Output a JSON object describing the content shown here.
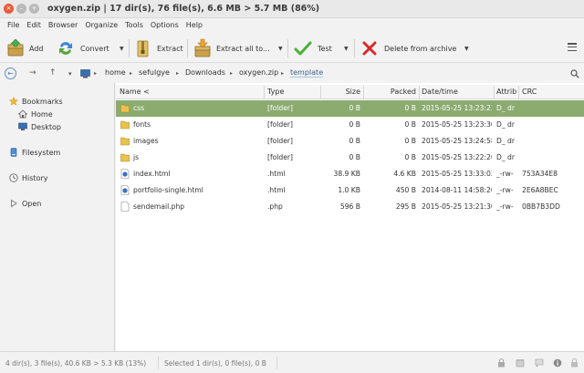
{
  "window": {
    "title": "oxygen.zip | 17 dir(s), 76 file(s), 6.6 MB > 5.7 MB (86%)",
    "close_glyph": "×",
    "min_glyph": "–",
    "max_glyph": "+"
  },
  "menu": [
    "File",
    "Edit",
    "Browser",
    "Organize",
    "Tools",
    "Options",
    "Help"
  ],
  "toolbar": {
    "add": "Add",
    "convert": "Convert",
    "extract": "Extract",
    "extract_all": "Extract all to...",
    "test": "Test",
    "delete": "Delete from archive",
    "dropdown_glyph": "▼"
  },
  "navbar": {
    "back_glyph": "←",
    "forward_glyph": "→",
    "up_glyph": "↑",
    "dropdown_glyph": "▾",
    "crumbs": [
      "home",
      "sefulgye",
      "Downloads",
      "oxygen.zip",
      "template"
    ],
    "separator_glyph": "▸"
  },
  "sidebar": {
    "bookmarks": "Bookmarks",
    "home": "Home",
    "desktop": "Desktop",
    "filesystem": "Filesystem",
    "history": "History",
    "open": "Open"
  },
  "columns": [
    "Name <",
    "Type",
    "Size",
    "Packed",
    "Date/time",
    "Attrib",
    "CRC"
  ],
  "files": [
    {
      "name": "css",
      "type": "[folder]",
      "size": "0 B",
      "packed": "0 B",
      "date": "2015-05-25 13:23:22",
      "attrib": "D_ dr",
      "crc": "",
      "icon": "folder-icon",
      "selected": true
    },
    {
      "name": "fonts",
      "type": "[folder]",
      "size": "0 B",
      "packed": "0 B",
      "date": "2015-05-25 13:23:30",
      "attrib": "D_ dr",
      "crc": "",
      "icon": "folder-icon",
      "selected": false
    },
    {
      "name": "images",
      "type": "[folder]",
      "size": "0 B",
      "packed": "0 B",
      "date": "2015-05-25 13:24:58",
      "attrib": "D_ dr",
      "crc": "",
      "icon": "folder-icon",
      "selected": false
    },
    {
      "name": "js",
      "type": "[folder]",
      "size": "0 B",
      "packed": "0 B",
      "date": "2015-05-25 13:22:26",
      "attrib": "D_ dr",
      "crc": "",
      "icon": "folder-icon",
      "selected": false
    },
    {
      "name": "index.html",
      "type": ".html",
      "size": "38.9 KB",
      "packed": "4.6 KB",
      "date": "2015-05-25 13:33:02",
      "attrib": "_-rw-",
      "crc": "753A34E8",
      "icon": "html-file-icon",
      "selected": false
    },
    {
      "name": "portfolio-single.html",
      "type": ".html",
      "size": "1.0 KB",
      "packed": "450 B",
      "date": "2014-08-11 14:58:20",
      "attrib": "_-rw-",
      "crc": "2E6A8BEC",
      "icon": "html-file-icon",
      "selected": false
    },
    {
      "name": "sendemail.php",
      "type": ".php",
      "size": "596 B",
      "packed": "295 B",
      "date": "2015-05-25 13:21:30",
      "attrib": "_-rw-",
      "crc": "0BB7B3DD",
      "icon": "php-file-icon",
      "selected": false
    }
  ],
  "status": {
    "left": "4 dir(s), 3 file(s), 40.6 KB > 5.3 KB (13%)",
    "selection": "Selected 1 dir(s), 0 file(s), 0 B"
  },
  "colors": {
    "selection": "#8bab6f",
    "close_button": "#e85b3b",
    "folder": "#e8c14f"
  }
}
